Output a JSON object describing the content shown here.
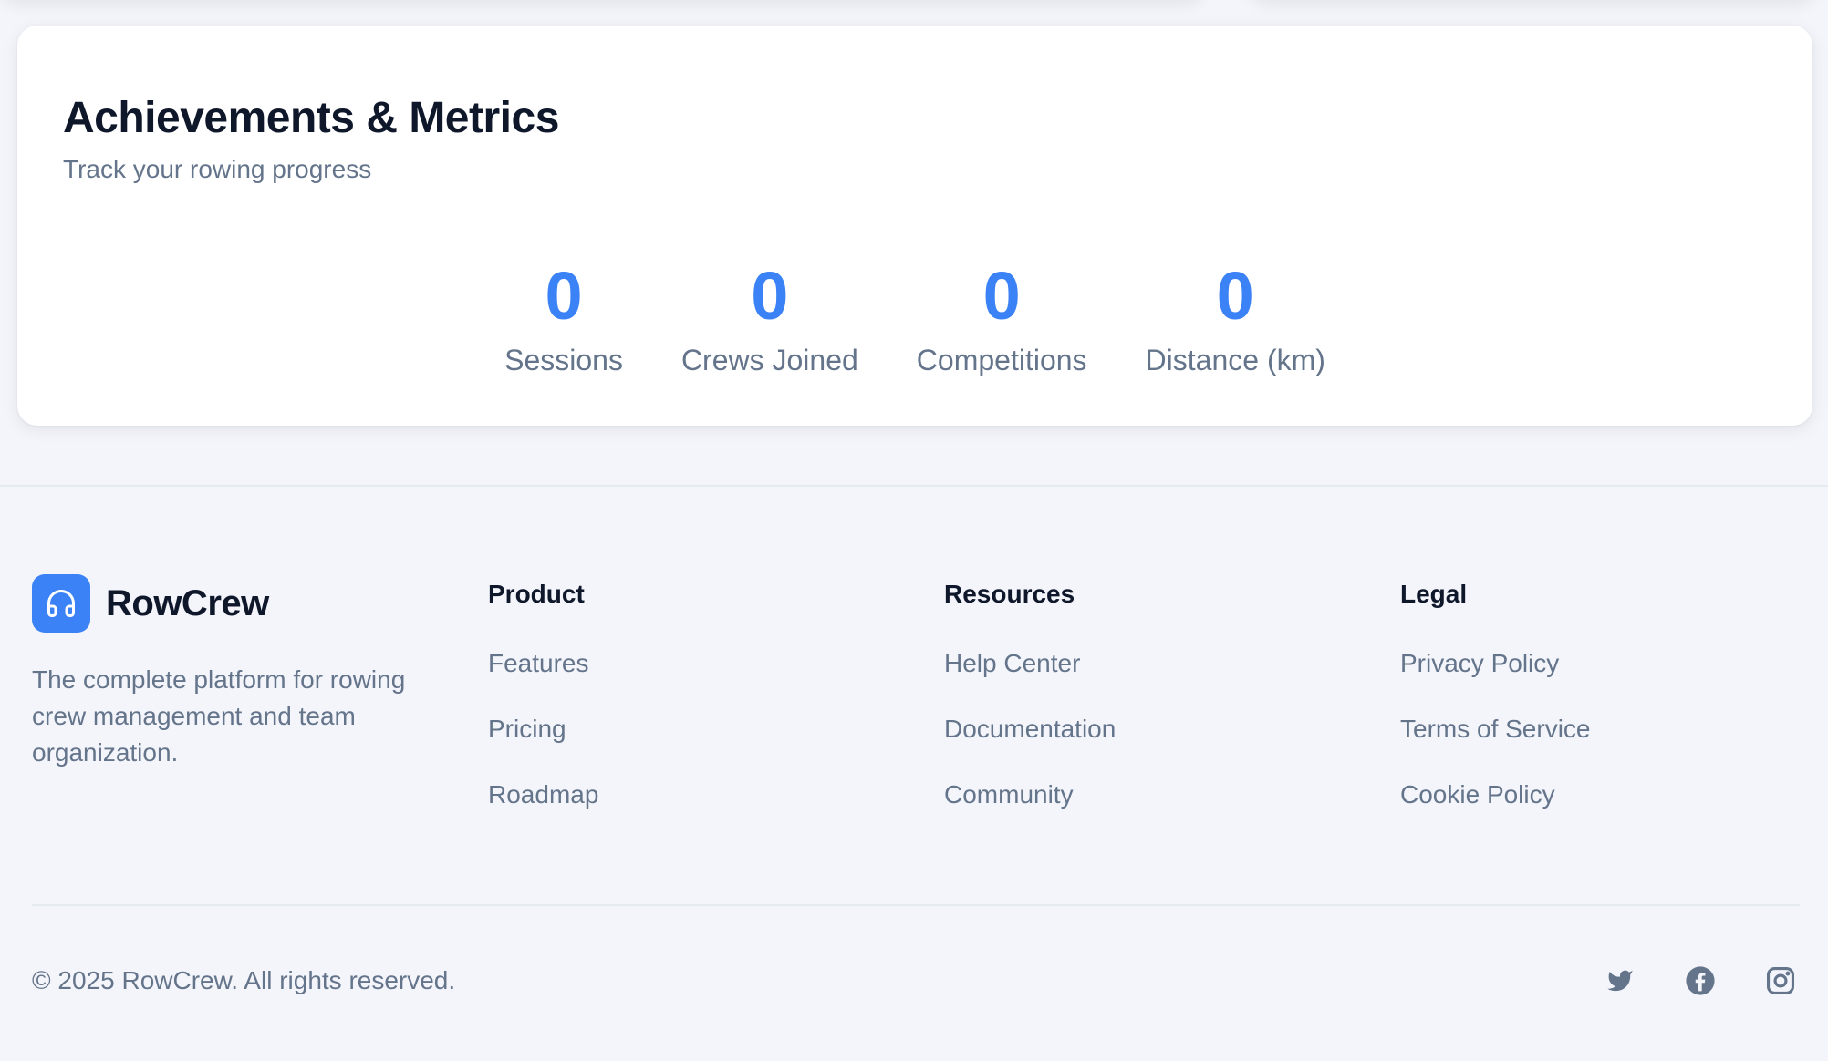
{
  "metrics": {
    "title": "Achievements & Metrics",
    "subtitle": "Track your rowing progress",
    "stats": [
      {
        "value": "0",
        "label": "Sessions"
      },
      {
        "value": "0",
        "label": "Crews Joined"
      },
      {
        "value": "0",
        "label": "Competitions"
      },
      {
        "value": "0",
        "label": "Distance (km)"
      }
    ]
  },
  "footer": {
    "brand": {
      "name": "RowCrew",
      "description": "The complete platform for rowing crew management and team organization.",
      "logo_icon": "headphones-icon"
    },
    "columns": [
      {
        "title": "Product",
        "links": [
          "Features",
          "Pricing",
          "Roadmap"
        ]
      },
      {
        "title": "Resources",
        "links": [
          "Help Center",
          "Documentation",
          "Community"
        ]
      },
      {
        "title": "Legal",
        "links": [
          "Privacy Policy",
          "Terms of Service",
          "Cookie Policy"
        ]
      }
    ],
    "copyright": "© 2025 RowCrew. All rights reserved.",
    "socials": [
      "twitter-icon",
      "facebook-icon",
      "instagram-icon"
    ]
  },
  "colors": {
    "accent": "#3b82f6",
    "heading": "#0f172a",
    "muted": "#64748b",
    "background": "#f3f5fa"
  }
}
